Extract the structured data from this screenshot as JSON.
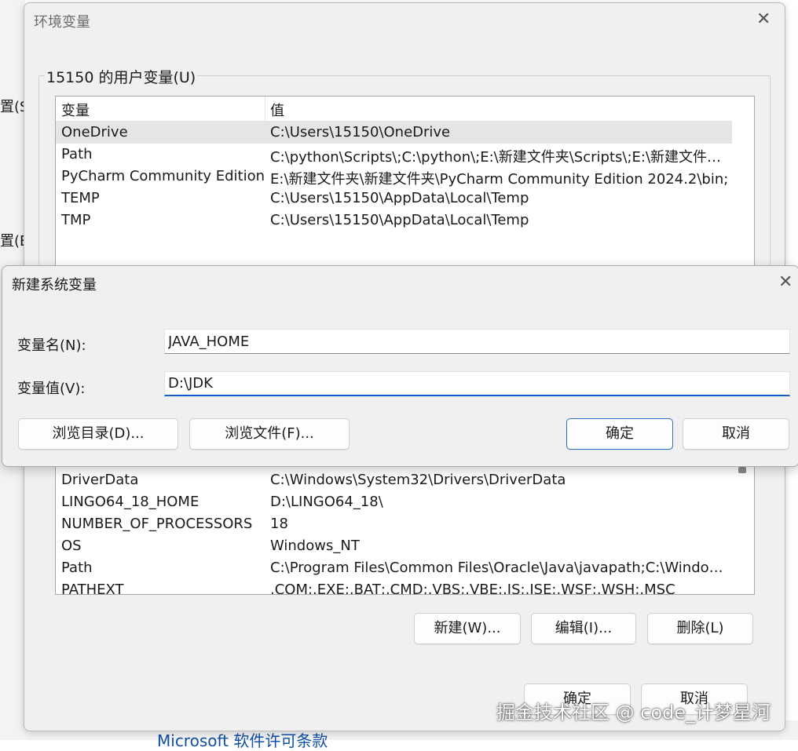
{
  "background": {
    "left_texts": [
      "置(S)",
      "置(E)"
    ],
    "link": "Microsoft 软件许可条款"
  },
  "env_dialog": {
    "title": "环境变量",
    "user_group_label": "15150 的用户变量(U)",
    "columns": [
      "变量",
      "值"
    ],
    "user_vars": [
      {
        "name": "OneDrive",
        "value": "C:\\Users\\15150\\OneDrive"
      },
      {
        "name": "Path",
        "value": "C:\\python\\Scripts\\;C:\\python\\;E:\\新建文件夹\\Scripts\\;E:\\新建文件夹\\;..."
      },
      {
        "name": "PyCharm Community Edition",
        "value": "E:\\新建文件夹\\新建文件夹\\PyCharm Community Edition 2024.2\\bin;"
      },
      {
        "name": "TEMP",
        "value": "C:\\Users\\15150\\AppData\\Local\\Temp"
      },
      {
        "name": "TMP",
        "value": "C:\\Users\\15150\\AppData\\Local\\Temp"
      }
    ],
    "selected_user_var_index": 0,
    "system_vars": [
      {
        "name": "DriverData",
        "value": "C:\\Windows\\System32\\Drivers\\DriverData"
      },
      {
        "name": "LINGO64_18_HOME",
        "value": "D:\\LINGO64_18\\"
      },
      {
        "name": "NUMBER_OF_PROCESSORS",
        "value": "18"
      },
      {
        "name": "OS",
        "value": "Windows_NT"
      },
      {
        "name": "Path",
        "value": "C:\\Program Files\\Common Files\\Oracle\\Java\\javapath;C:\\Windows\\..."
      },
      {
        "name": "PATHEXT",
        "value": ".COM;.EXE;.BAT;.CMD;.VBS;.VBE;.JS;.JSE;.WSF;.WSH;.MSC"
      }
    ],
    "system_buttons": {
      "new": "新建(W)...",
      "edit": "编辑(I)...",
      "delete": "删除(L)"
    },
    "ok": "确定",
    "cancel": "取消"
  },
  "new_var_dialog": {
    "title": "新建系统变量",
    "name_label": "变量名(N):",
    "value_label": "变量值(V):",
    "name_value": "JAVA_HOME",
    "value_value": "D:\\JDK",
    "browse_dir": "浏览目录(D)...",
    "browse_file": "浏览文件(F)...",
    "ok": "确定",
    "cancel": "取消"
  },
  "watermark": "掘金技术社区 @ code_计梦星河"
}
